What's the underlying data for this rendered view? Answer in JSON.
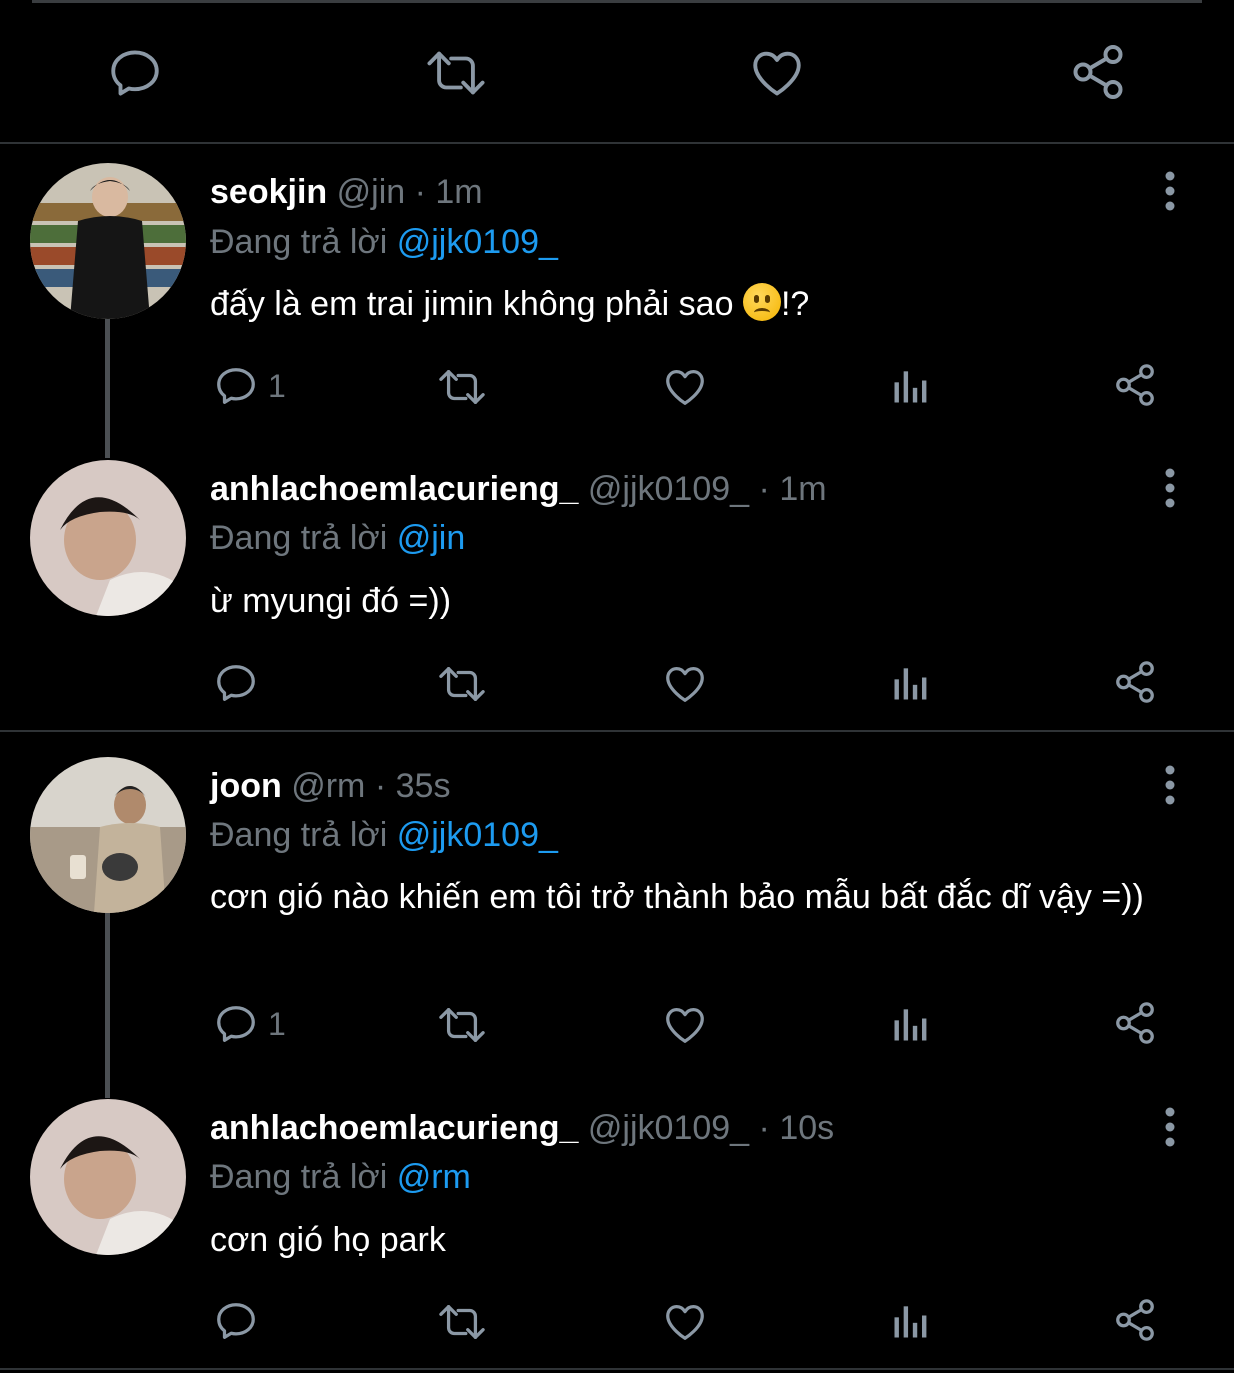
{
  "top_actions": {
    "reply_icon": "reply-icon",
    "retweet_icon": "retweet-icon",
    "like_icon": "heart-icon",
    "share_icon": "share-icon"
  },
  "tweets": [
    {
      "name": "seokjin",
      "handle": "@jin",
      "sep": "·",
      "time": "1m",
      "reply_prefix": "Đang trả lời",
      "reply_to": "@jjk0109_",
      "text": "đấy là em trai jimin không phải sao",
      "text_suffix": "!?",
      "reply_count": "1"
    },
    {
      "name": "anhlachoemlacurieng_",
      "handle": "@jjk0109_",
      "sep": "·",
      "time": "1m",
      "reply_prefix": "Đang trả lời",
      "reply_to": "@jin",
      "text": "ừ myungi đó =))",
      "reply_count": ""
    },
    {
      "name": "joon",
      "handle": "@rm",
      "sep": "·",
      "time": "35s",
      "reply_prefix": "Đang trả lời",
      "reply_to": "@jjk0109_",
      "text": "cơn gió nào khiến em tôi trở thành bảo mẫu bất đắc dĩ vậy =))",
      "reply_count": "1"
    },
    {
      "name": "anhlachoemlacurieng_",
      "handle": "@jjk0109_",
      "sep": "·",
      "time": "10s",
      "reply_prefix": "Đang trả lời",
      "reply_to": "@rm",
      "text": "cơn gió họ park",
      "reply_count": ""
    }
  ],
  "colors": {
    "background": "#000000",
    "accent": "#1d9bf0",
    "muted": "#6e767d",
    "text": "#ffffff"
  }
}
